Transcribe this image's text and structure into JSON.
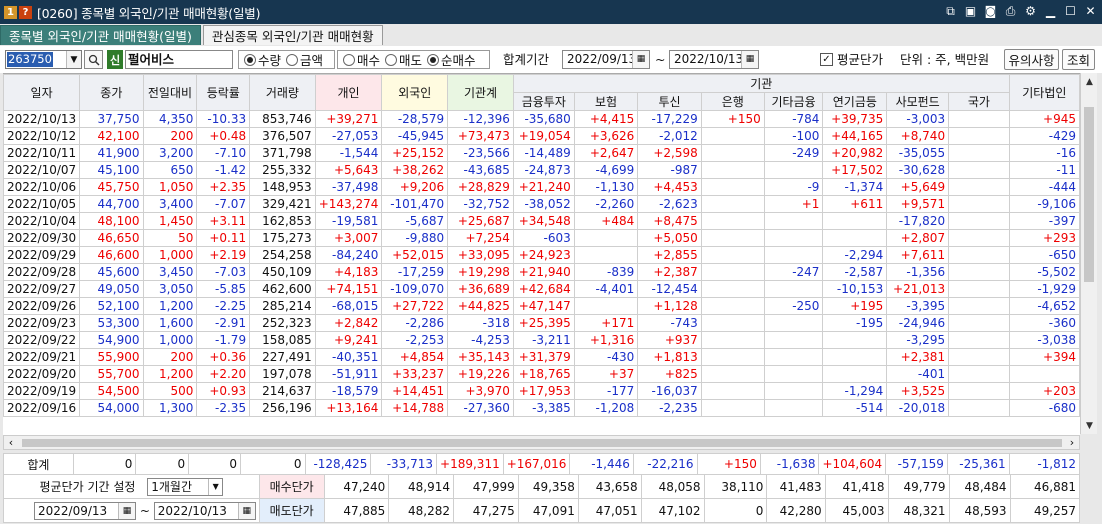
{
  "window": {
    "num": "1",
    "help": "?",
    "title": "[0260] 종목별 외국인/기관 매매현황(일별)"
  },
  "tabs": [
    "종목별 외국인/기관 매매현황(일별)",
    "관심종목 외국인/기관 매매현황"
  ],
  "controls": {
    "code": "263750",
    "badge": "신",
    "name": "펄어비스",
    "radio1": [
      {
        "label": "수량",
        "on": true
      },
      {
        "label": "금액",
        "on": false
      }
    ],
    "radio2": [
      {
        "label": "매수",
        "on": false
      },
      {
        "label": "매도",
        "on": false
      },
      {
        "label": "순매수",
        "on": true
      }
    ],
    "period_label": "합계기간",
    "date_from": "2022/09/13",
    "tilde": "~",
    "date_to": "2022/10/13",
    "avg_label": "평균단가",
    "avg_checked": true,
    "unit": "단위 : 주, 백만원",
    "notice_btn": "유의사항",
    "query_btn": "조회"
  },
  "headers": {
    "date": "일자",
    "close": "종가",
    "change": "전일대비",
    "rate": "등락률",
    "volume": "거래량",
    "indiv": "개인",
    "foreign": "외국인",
    "inst": "기관계",
    "inst_group": "기관",
    "finance": "금융투자",
    "insurance": "보험",
    "trust": "투신",
    "bank": "은행",
    "etcfin": "기타금융",
    "pension": "연기금등",
    "private": "사모펀드",
    "nation": "국가",
    "etccorp": "기타법인"
  },
  "rows": [
    [
      "2022/10/13",
      "37,750",
      "4,350",
      "-10.33",
      "853,746",
      "+39,271",
      "-28,579",
      "-12,396",
      "-35,680",
      "+4,415",
      "-17,229",
      "+150",
      "-784",
      "+39,735",
      "-3,003",
      "",
      "+945",
      "b"
    ],
    [
      "2022/10/12",
      "42,100",
      "200",
      "+0.48",
      "376,507",
      "-27,053",
      "-45,945",
      "+73,473",
      "+19,054",
      "+3,626",
      "-2,012",
      "",
      "-100",
      "+44,165",
      "+8,740",
      "",
      "-429",
      "r"
    ],
    [
      "2022/10/11",
      "41,900",
      "3,200",
      "-7.10",
      "371,798",
      "-1,544",
      "+25,152",
      "-23,566",
      "-14,489",
      "+2,647",
      "+2,598",
      "",
      "-249",
      "+20,982",
      "-35,055",
      "",
      "-16",
      "b"
    ],
    [
      "2022/10/07",
      "45,100",
      "650",
      "-1.42",
      "255,332",
      "+5,643",
      "+38,262",
      "-43,685",
      "-24,873",
      "-4,699",
      "-987",
      "",
      "",
      "+17,502",
      "-30,628",
      "",
      "-11",
      "b"
    ],
    [
      "2022/10/06",
      "45,750",
      "1,050",
      "+2.35",
      "148,953",
      "-37,498",
      "+9,206",
      "+28,829",
      "+21,240",
      "-1,130",
      "+4,453",
      "",
      "-9",
      "-1,374",
      "+5,649",
      "",
      "-444",
      "r"
    ],
    [
      "2022/10/05",
      "44,700",
      "3,400",
      "-7.07",
      "329,421",
      "+143,274",
      "-101,470",
      "-32,752",
      "-38,052",
      "-2,260",
      "-2,623",
      "",
      "+1",
      "+611",
      "+9,571",
      "",
      "-9,106",
      "b"
    ],
    [
      "2022/10/04",
      "48,100",
      "1,450",
      "+3.11",
      "162,853",
      "-19,581",
      "-5,687",
      "+25,687",
      "+34,548",
      "+484",
      "+8,475",
      "",
      "",
      "",
      "-17,820",
      "",
      "-397",
      "r"
    ],
    [
      "2022/09/30",
      "46,650",
      "50",
      "+0.11",
      "175,273",
      "+3,007",
      "-9,880",
      "+7,254",
      "-603",
      "",
      "+5,050",
      "",
      "",
      "",
      "+2,807",
      "",
      "+293",
      "r"
    ],
    [
      "2022/09/29",
      "46,600",
      "1,000",
      "+2.19",
      "254,258",
      "-84,240",
      "+52,015",
      "+33,095",
      "+24,923",
      "",
      "+2,855",
      "",
      "",
      "-2,294",
      "+7,611",
      "",
      "-650",
      "r"
    ],
    [
      "2022/09/28",
      "45,600",
      "3,450",
      "-7.03",
      "450,109",
      "+4,183",
      "-17,259",
      "+19,298",
      "+21,940",
      "-839",
      "+2,387",
      "",
      "-247",
      "-2,587",
      "-1,356",
      "",
      "-5,502",
      "b"
    ],
    [
      "2022/09/27",
      "49,050",
      "3,050",
      "-5.85",
      "462,600",
      "+74,151",
      "-109,070",
      "+36,689",
      "+42,684",
      "-4,401",
      "-12,454",
      "",
      "",
      "-10,153",
      "+21,013",
      "",
      "-1,929",
      "b"
    ],
    [
      "2022/09/26",
      "52,100",
      "1,200",
      "-2.25",
      "285,214",
      "-68,015",
      "+27,722",
      "+44,825",
      "+47,147",
      "",
      "+1,128",
      "",
      "-250",
      "+195",
      "-3,395",
      "",
      "-4,652",
      "b"
    ],
    [
      "2022/09/23",
      "53,300",
      "1,600",
      "-2.91",
      "252,323",
      "+2,842",
      "-2,286",
      "-318",
      "+25,395",
      "+171",
      "-743",
      "",
      "",
      "-195",
      "-24,946",
      "",
      "-360",
      "b"
    ],
    [
      "2022/09/22",
      "54,900",
      "1,000",
      "-1.79",
      "158,085",
      "+9,241",
      "-2,253",
      "-4,253",
      "-3,211",
      "+1,316",
      "+937",
      "",
      "",
      "",
      "-3,295",
      "",
      "-3,038",
      "b"
    ],
    [
      "2022/09/21",
      "55,900",
      "200",
      "+0.36",
      "227,491",
      "-40,351",
      "+4,854",
      "+35,143",
      "+31,379",
      "-430",
      "+1,813",
      "",
      "",
      "",
      "+2,381",
      "",
      "+394",
      "r"
    ],
    [
      "2022/09/20",
      "55,700",
      "1,200",
      "+2.20",
      "197,078",
      "-51,911",
      "+33,237",
      "+19,226",
      "+18,765",
      "+37",
      "+825",
      "",
      "",
      "",
      "-401",
      "",
      "",
      "r"
    ],
    [
      "2022/09/19",
      "54,500",
      "500",
      "+0.93",
      "214,637",
      "-18,579",
      "+14,451",
      "+3,970",
      "+17,953",
      "-177",
      "-16,037",
      "",
      "",
      "-1,294",
      "+3,525",
      "",
      "+203",
      "r"
    ],
    [
      "2022/09/16",
      "54,000",
      "1,300",
      "-2.35",
      "256,196",
      "+13,164",
      "+14,788",
      "-27,360",
      "-3,385",
      "-1,208",
      "-2,235",
      "",
      "",
      "-514",
      "-20,018",
      "",
      "-680",
      "b"
    ]
  ],
  "totals": {
    "label": "합계",
    "vals": [
      "0",
      "0",
      "0",
      "0",
      "-128,425",
      "-33,713",
      "+189,311",
      "+167,016",
      "-1,446",
      "-22,216",
      "+150",
      "-1,638",
      "+104,604",
      "-57,159",
      "-25,361",
      "-1,812"
    ]
  },
  "bottom": {
    "period_label": "평균단가 기간 설정",
    "period_sel": "1개월간",
    "from": "2022/09/13",
    "tilde": "~",
    "to": "2022/10/13",
    "buy_label": "매수단가",
    "sell_label": "매도단가",
    "buy": [
      "47,240",
      "48,914",
      "47,999",
      "49,358",
      "43,658",
      "48,058",
      "38,110",
      "41,483",
      "41,418",
      "49,779",
      "48,484",
      "46,881"
    ],
    "sell": [
      "47,885",
      "48,282",
      "47,275",
      "47,091",
      "47,051",
      "47,102",
      "0",
      "42,280",
      "45,003",
      "48,321",
      "48,593",
      "49,257"
    ]
  },
  "colors": {
    "red": "#e00000",
    "blue": "#1a2fc8",
    "title_bg": "#173650",
    "tab_active": "#3c7f7a"
  }
}
